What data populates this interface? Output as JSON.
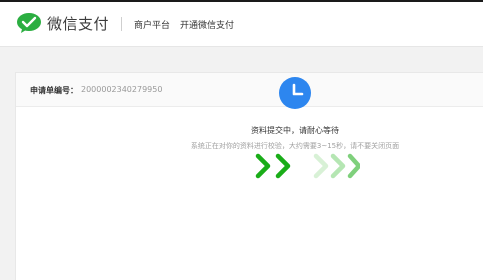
{
  "header": {
    "logo_text": "微信支付",
    "platform": "商户平台",
    "service": "开通微信支付"
  },
  "application": {
    "label": "申请单编号：",
    "number": "2000002340279950"
  },
  "status": {
    "title": "资料提交中，请耐心等待",
    "subtitle": "系统正在对你的资料进行校验，大约需要3~15秒，请不要关闭页面",
    "icon": "clock-icon"
  },
  "colors": {
    "brand_green": "#2bae41",
    "accent_blue": "#2d86ef",
    "arrow_green": "#1aad19",
    "arrow_light": "#b5e6b3"
  }
}
